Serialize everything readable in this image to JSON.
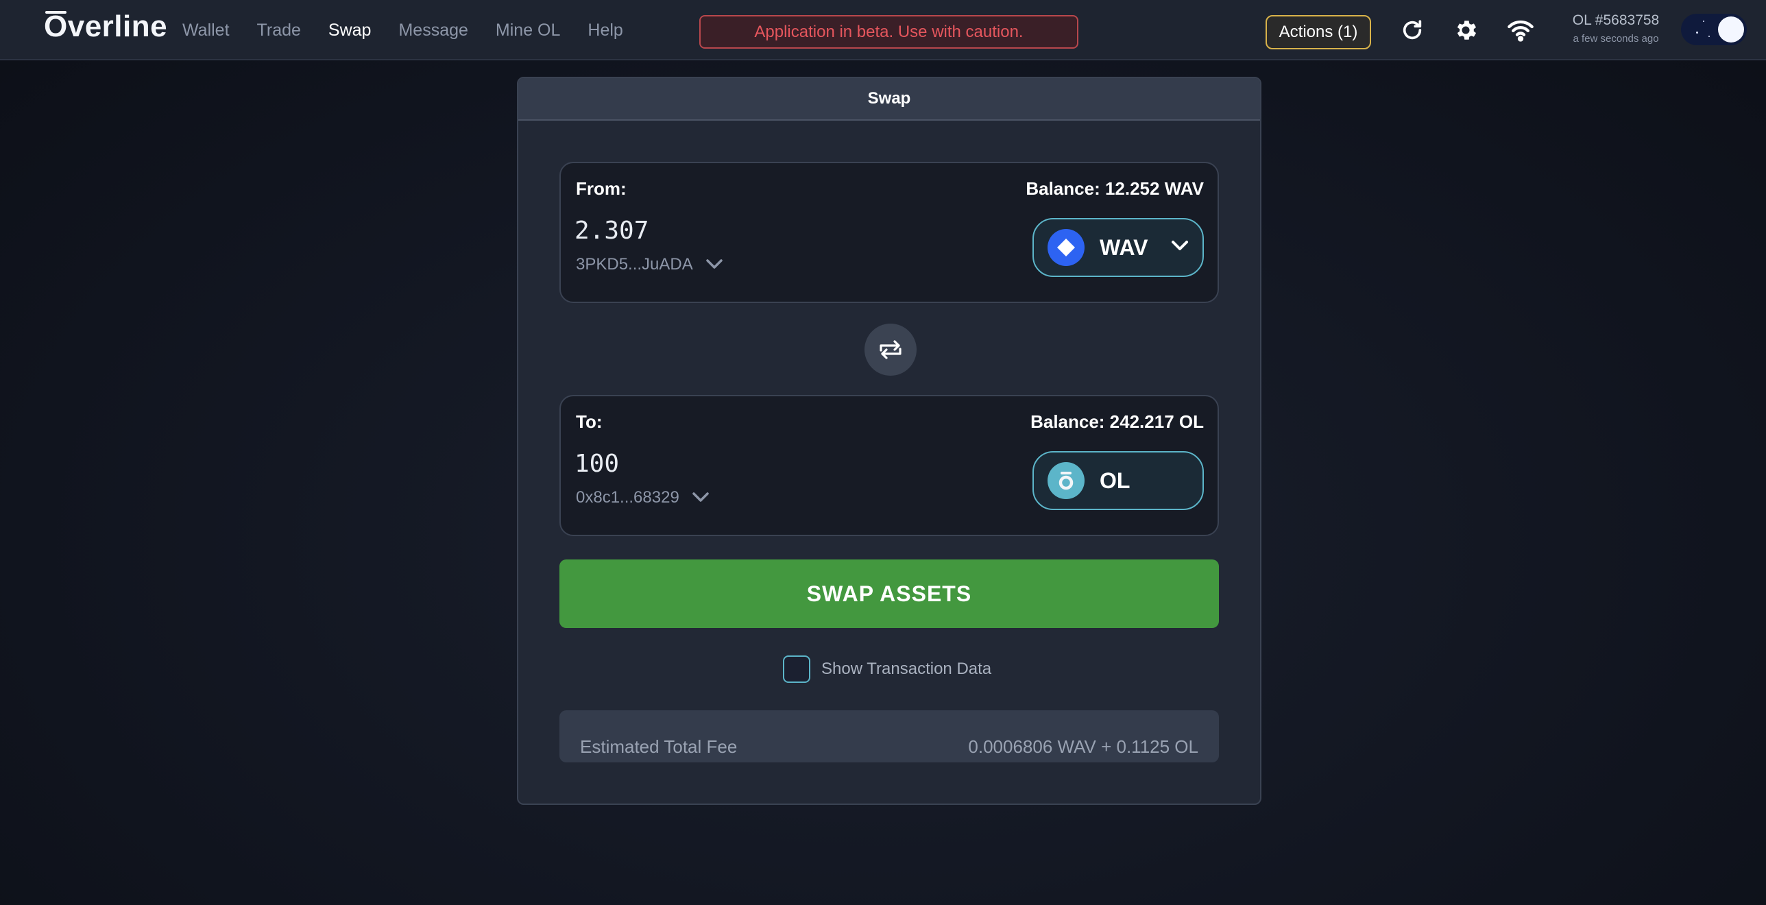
{
  "app": {
    "logo_prefix": "O",
    "logo_rest": "verline"
  },
  "nav": {
    "items": [
      {
        "label": "Wallet",
        "active": false
      },
      {
        "label": "Trade",
        "active": false
      },
      {
        "label": "Swap",
        "active": true
      },
      {
        "label": "Message",
        "active": false
      },
      {
        "label": "Mine OL",
        "active": false
      },
      {
        "label": "Help",
        "active": false
      }
    ]
  },
  "banner": {
    "text": "Application in beta. Use with caution."
  },
  "header": {
    "actions_label": "Actions (1)",
    "icons": [
      "refresh-icon",
      "gear-icon",
      "wifi-icon"
    ],
    "block_number": "OL #5683758",
    "block_time": "a few seconds ago",
    "theme": "dark"
  },
  "swap": {
    "title": "Swap",
    "from": {
      "label": "From:",
      "balance": "Balance: 12.252 WAV",
      "amount": "2.307",
      "address": "3PKD5...JuADA",
      "token": "WAV",
      "token_icon": "waves-diamond-icon",
      "token_color": "#2d63f2"
    },
    "to": {
      "label": "To:",
      "balance": "Balance: 242.217 OL",
      "amount": "100",
      "address": "0x8c1...68329",
      "token": "OL",
      "token_icon": "overline-icon",
      "token_color": "#5cb5c9"
    },
    "swap_button": "SWAP ASSETS",
    "show_tx_label": "Show Transaction Data",
    "show_tx_checked": false,
    "fee_label": "Estimated Total Fee",
    "fee_value": "0.0006806 WAV + 0.1125 OL"
  },
  "colors": {
    "accent": "#5cb5c9",
    "primary_button": "#43983f",
    "warning_border": "#b8474c",
    "actions_border": "#d8b24a"
  }
}
